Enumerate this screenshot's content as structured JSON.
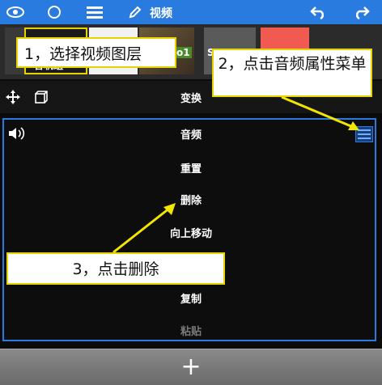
{
  "toolbar": {
    "title": "视频",
    "icons": [
      "eye-icon",
      "circle-icon",
      "menu-icon",
      "pencil-icon",
      "undo-icon",
      "redo-icon"
    ]
  },
  "layers": {
    "selected_layer_label": "音轨组",
    "thumb_label_1": "o1",
    "thumb_label_2": "S"
  },
  "transform_row": {
    "title": "变换"
  },
  "audio_menu": {
    "title": "音频",
    "items": [
      "重置",
      "删除",
      "向上移动",
      "复制",
      "粘贴"
    ]
  },
  "add_bar": {
    "label": "+"
  },
  "callouts": {
    "step1": "1，选择视频图层",
    "step2": "2，点击音频属性菜单",
    "step3": "3，点击删除"
  },
  "colors": {
    "accent": "#2a7be0",
    "callout_border": "#e6d400",
    "arrow": "#f2e600"
  }
}
